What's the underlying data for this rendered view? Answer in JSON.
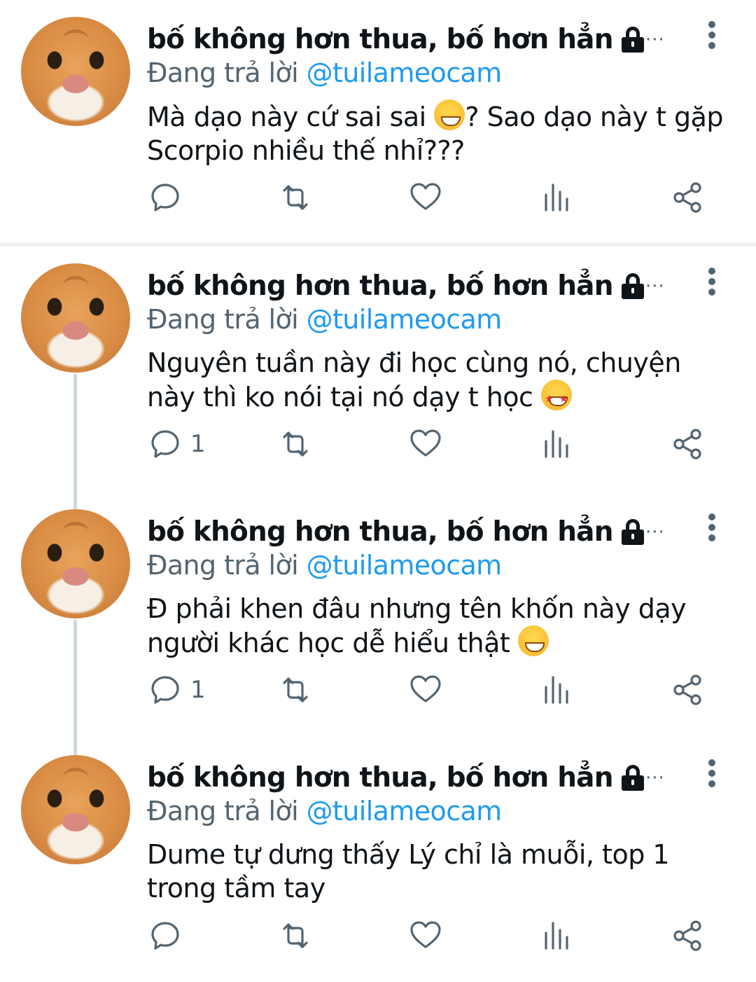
{
  "tweets": [
    {
      "name": "bố không hơn thua, bố hơn hẳn",
      "reply_prefix": "Đang trả lời ",
      "reply_handle": "@tuilameocam",
      "text_before": "Mà dạo này cứ sai sai ",
      "emoji": "grinning-sweat-emoji",
      "text_after": "? Sao dạo này t gặp Scorpio nhiều thế nhỉ???",
      "reply_count": ""
    },
    {
      "name": "bố không hơn thua, bố hơn hẳn",
      "reply_prefix": "Đang trả lời ",
      "reply_handle": "@tuilameocam",
      "text_before": "Nguyên tuần này đi học cùng nó, chuyện này thì ko nói tại nó dạy t học  ",
      "emoji": "star-struck-emoji",
      "text_after": "",
      "reply_count": "1"
    },
    {
      "name": "bố không hơn thua, bố hơn hẳn",
      "reply_prefix": "Đang trả lời ",
      "reply_handle": "@tuilameocam",
      "text_before": "Đ phải khen đâu nhưng tên khốn này dạy người khác học dễ hiểu thật ",
      "emoji": "grinning-sweat-emoji",
      "text_after": "",
      "reply_count": "1"
    },
    {
      "name": "bố không hơn thua, bố hơn hẳn",
      "reply_prefix": "Đang trả lời ",
      "reply_handle": "@tuilameocam",
      "text_before": "Dume tự dưng thấy Lý chỉ là muỗi, top 1 trong tầm tay",
      "emoji": "",
      "text_after": "",
      "reply_count": ""
    }
  ],
  "more_horizontal_label": "···",
  "icons": [
    "reply-icon",
    "retweet-icon",
    "like-icon",
    "views-icon",
    "share-icon",
    "lock-icon",
    "more-icon"
  ],
  "colors": {
    "link": "#1d9bf0",
    "muted": "#536471",
    "text": "#0f1419",
    "thread_line": "#cfd9de",
    "divider": "#eff3f4"
  }
}
